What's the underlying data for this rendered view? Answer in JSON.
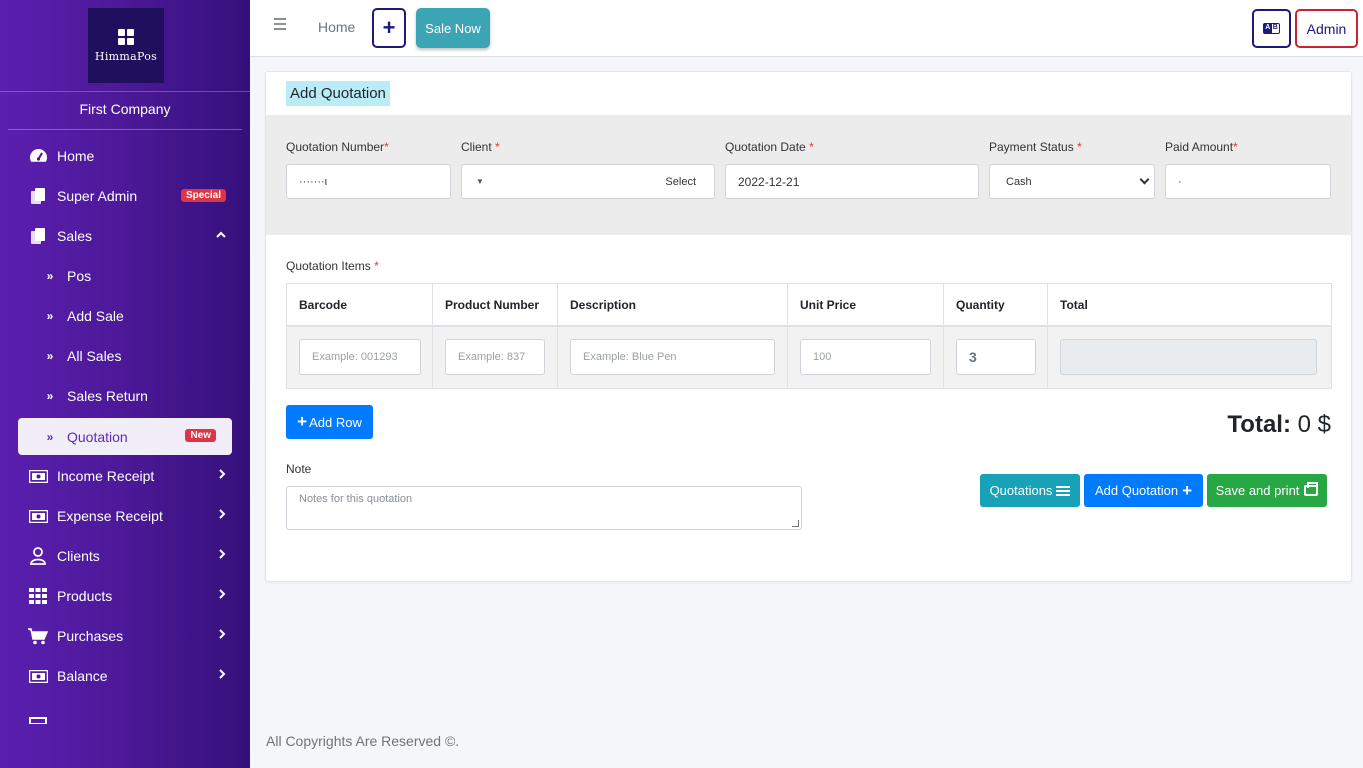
{
  "brand": {
    "logo_text": "HimmaPos",
    "company": "First Company"
  },
  "sidebar": {
    "items": [
      {
        "label": "Home",
        "icon": "tachometer-icon"
      },
      {
        "label": "Super Admin",
        "icon": "copy-icon",
        "badge": "Special"
      },
      {
        "label": "Sales",
        "icon": "copy-icon",
        "expanded": true
      },
      {
        "label": "Pos",
        "icon": "double-chevron-icon"
      },
      {
        "label": "Add Sale",
        "icon": "double-chevron-icon"
      },
      {
        "label": "All Sales",
        "icon": "double-chevron-icon"
      },
      {
        "label": "Sales Return",
        "icon": "double-chevron-icon"
      },
      {
        "label": "Quotation",
        "icon": "double-chevron-icon",
        "badge": "New",
        "active": true
      },
      {
        "label": "Income Receipt",
        "icon": "money-icon"
      },
      {
        "label": "Expense Receipt",
        "icon": "money-icon"
      },
      {
        "label": "Clients",
        "icon": "user-icon"
      },
      {
        "label": "Products",
        "icon": "grid-icon"
      },
      {
        "label": "Purchases",
        "icon": "cart-icon"
      },
      {
        "label": "Balance",
        "icon": "money-icon"
      }
    ]
  },
  "topbar": {
    "home_label": "Home",
    "sale_now_label": "Sale Now",
    "admin_label": "Admin"
  },
  "form": {
    "title": "Add Quotation",
    "quotation_number": {
      "label": "Quotation Number",
      "value": "·······ι"
    },
    "client": {
      "label": "Client",
      "value": "Select"
    },
    "quotation_date": {
      "label": "Quotation Date",
      "value": "2022-12-21"
    },
    "payment_status": {
      "label": "Payment Status",
      "value": "Cash"
    },
    "paid_amount": {
      "label": "Paid Amount",
      "value": "·"
    }
  },
  "items": {
    "label": "Quotation Items",
    "columns": [
      "Barcode",
      "Product Number",
      "Description",
      "Unit Price",
      "Quantity",
      "Total"
    ],
    "row": {
      "barcode_placeholder": "Example: 001293",
      "product_number_placeholder": "Example: 837",
      "description_placeholder": "Example: Blue Pen",
      "unit_price_placeholder": "100",
      "quantity_value": "3",
      "total_value": ""
    }
  },
  "actions": {
    "add_row_label": "Add Row",
    "total_label": "Total:",
    "total_value": "0 $",
    "note_label": "Note",
    "note_placeholder": "Notes for this quotation",
    "quotations_label": "Quotations",
    "add_quotation_label": "Add Quotation",
    "save_print_label": "Save and print"
  },
  "footer": {
    "text": "All Copyrights Are Reserved ©."
  },
  "colors": {
    "sidebar_start": "#5b1fb0",
    "primary": "#007bff",
    "info": "#17a2b8",
    "success": "#28a745",
    "danger": "#dc3545"
  }
}
